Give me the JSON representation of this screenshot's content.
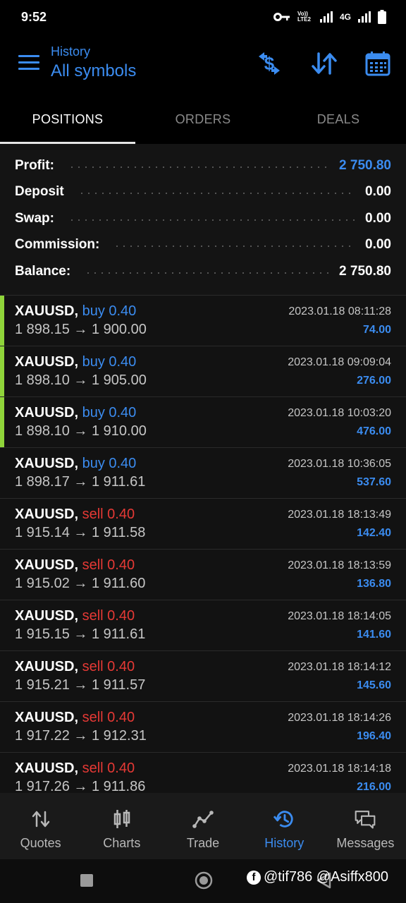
{
  "status_bar": {
    "time": "9:52",
    "lte_label": "Vo)) LTE2",
    "network_label": "4G"
  },
  "header": {
    "subtitle": "History",
    "title": "All symbols",
    "icons": [
      "menu-icon",
      "currency-exchange-icon",
      "sort-icon",
      "calendar-icon"
    ],
    "accent_color": "#3b8cf0"
  },
  "tabs": [
    {
      "label": "POSITIONS",
      "active": true
    },
    {
      "label": "ORDERS",
      "active": false
    },
    {
      "label": "DEALS",
      "active": false
    }
  ],
  "summary": {
    "profit": {
      "label": "Profit:",
      "value": "2 750.80"
    },
    "deposit": {
      "label": "Deposit",
      "value": "0.00"
    },
    "swap": {
      "label": "Swap:",
      "value": "0.00"
    },
    "commission": {
      "label": "Commission:",
      "value": "0.00"
    },
    "balance": {
      "label": "Balance:",
      "value": "2 750.80"
    }
  },
  "deals": [
    {
      "symbol": "XAUUSD,",
      "type": "buy",
      "volume": "buy 0.40",
      "prices": "1 898.15 → 1 900.00",
      "time": "2023.01.18 08:11:28",
      "profit": "74.00",
      "highlight": true
    },
    {
      "symbol": "XAUUSD,",
      "type": "buy",
      "volume": "buy 0.40",
      "prices": "1 898.10 → 1 905.00",
      "time": "2023.01.18 09:09:04",
      "profit": "276.00",
      "highlight": true
    },
    {
      "symbol": "XAUUSD,",
      "type": "buy",
      "volume": "buy 0.40",
      "prices": "1 898.10 → 1 910.00",
      "time": "2023.01.18 10:03:20",
      "profit": "476.00",
      "highlight": true
    },
    {
      "symbol": "XAUUSD,",
      "type": "buy",
      "volume": "buy 0.40",
      "prices": "1 898.17 → 1 911.61",
      "time": "2023.01.18 10:36:05",
      "profit": "537.60",
      "highlight": false
    },
    {
      "symbol": "XAUUSD,",
      "type": "sell",
      "volume": "sell 0.40",
      "prices": "1 915.14 → 1 911.58",
      "time": "2023.01.18 18:13:49",
      "profit": "142.40",
      "highlight": false
    },
    {
      "symbol": "XAUUSD,",
      "type": "sell",
      "volume": "sell 0.40",
      "prices": "1 915.02 → 1 911.60",
      "time": "2023.01.18 18:13:59",
      "profit": "136.80",
      "highlight": false
    },
    {
      "symbol": "XAUUSD,",
      "type": "sell",
      "volume": "sell 0.40",
      "prices": "1 915.15 → 1 911.61",
      "time": "2023.01.18 18:14:05",
      "profit": "141.60",
      "highlight": false
    },
    {
      "symbol": "XAUUSD,",
      "type": "sell",
      "volume": "sell 0.40",
      "prices": "1 915.21 → 1 911.57",
      "time": "2023.01.18 18:14:12",
      "profit": "145.60",
      "highlight": false
    },
    {
      "symbol": "XAUUSD,",
      "type": "sell",
      "volume": "sell 0.40",
      "prices": "1 917.22 → 1 912.31",
      "time": "2023.01.18 18:14:26",
      "profit": "196.40",
      "highlight": false
    },
    {
      "symbol": "XAUUSD,",
      "type": "sell",
      "volume": "sell 0.40",
      "prices": "1 917.26 → 1 911.86",
      "time": "2023.01.18 18:14:18",
      "profit": "216.00",
      "highlight": false
    }
  ],
  "bottom_nav": [
    {
      "label": "Quotes",
      "icon": "quotes-icon",
      "active": false
    },
    {
      "label": "Charts",
      "icon": "charts-icon",
      "active": false
    },
    {
      "label": "Trade",
      "icon": "trade-icon",
      "active": false
    },
    {
      "label": "History",
      "icon": "history-icon",
      "active": true
    },
    {
      "label": "Messages",
      "icon": "messages-icon",
      "active": false
    }
  ],
  "watermark": {
    "text": "@tif786 @Asiffx800"
  },
  "colors": {
    "buy": "#3b8cf0",
    "sell": "#e53935",
    "highlight": "#8fd43a"
  }
}
